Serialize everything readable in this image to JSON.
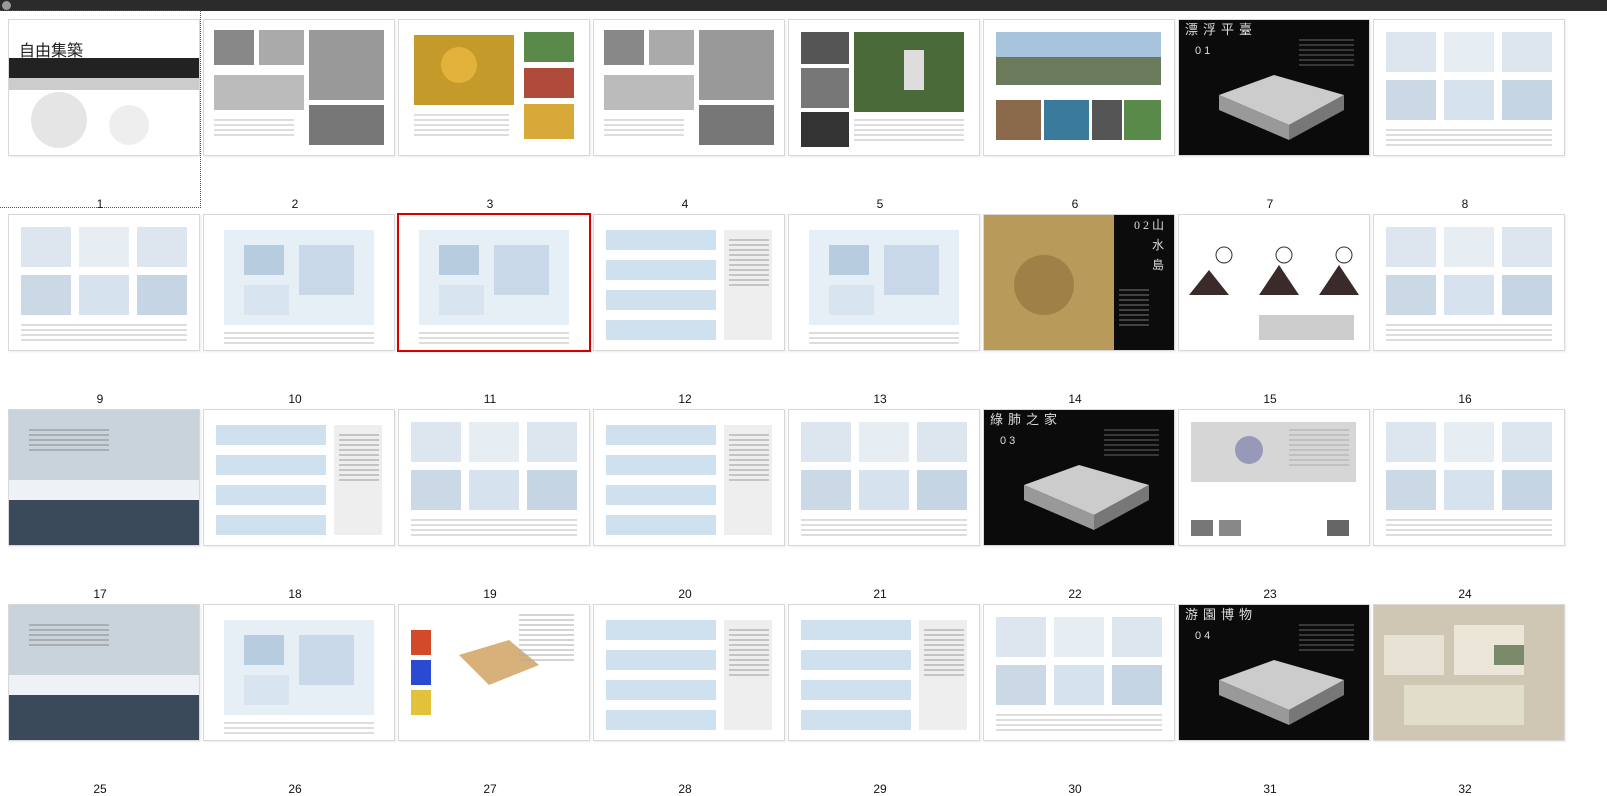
{
  "window": {
    "app_icon": "app-logo-icon"
  },
  "thumbnails": [
    {
      "page": "1",
      "title": "自由集築",
      "focused": true,
      "selected": false,
      "style": "cover"
    },
    {
      "page": "2",
      "style": "sketch"
    },
    {
      "page": "3",
      "style": "paint"
    },
    {
      "page": "4",
      "style": "sketch"
    },
    {
      "page": "5",
      "style": "photo-bw"
    },
    {
      "page": "6",
      "style": "landscape"
    },
    {
      "page": "7",
      "title": "漂浮平臺",
      "num": "0 1",
      "style": "dark"
    },
    {
      "page": "8",
      "style": "diagram"
    },
    {
      "page": "9",
      "style": "diagram"
    },
    {
      "page": "10",
      "style": "plan"
    },
    {
      "page": "11",
      "selected": true,
      "style": "plan"
    },
    {
      "page": "12",
      "style": "section"
    },
    {
      "page": "13",
      "style": "plan"
    },
    {
      "page": "14",
      "title": "山水島",
      "num": "0 2",
      "style": "sepia"
    },
    {
      "page": "15",
      "style": "mountain"
    },
    {
      "page": "16",
      "style": "diagram"
    },
    {
      "page": "17",
      "style": "blue"
    },
    {
      "page": "18",
      "style": "section"
    },
    {
      "page": "19",
      "style": "diagram"
    },
    {
      "page": "20",
      "style": "section"
    },
    {
      "page": "21",
      "style": "diagram"
    },
    {
      "page": "22",
      "title": "綠肺之家",
      "num": "0 3",
      "style": "dark"
    },
    {
      "page": "23",
      "style": "map"
    },
    {
      "page": "24",
      "style": "diagram"
    },
    {
      "page": "25",
      "style": "blue"
    },
    {
      "page": "26",
      "style": "plan"
    },
    {
      "page": "27",
      "style": "colorful"
    },
    {
      "page": "28",
      "style": "section"
    },
    {
      "page": "29",
      "style": "section"
    },
    {
      "page": "30",
      "style": "diagram"
    },
    {
      "page": "31",
      "title": "游園博物",
      "num": "0 4",
      "style": "dark"
    },
    {
      "page": "32",
      "style": "model"
    }
  ],
  "colors": {
    "selection_border": "#d20000",
    "page_label": "#111111",
    "topbar": "#2b2b2b"
  }
}
